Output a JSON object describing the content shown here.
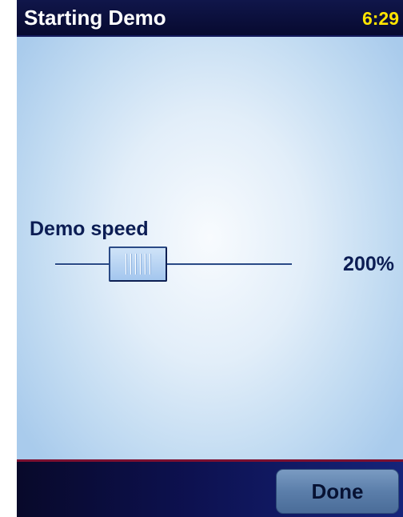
{
  "header": {
    "title": "Starting Demo",
    "clock": "6:29"
  },
  "setting": {
    "label": "Demo speed",
    "value_text": "200%",
    "slider_fraction": 0.3
  },
  "footer": {
    "done_label": "Done"
  },
  "colors": {
    "title_bar": "#070a30",
    "title_text": "#ffffff",
    "clock_text": "#ffe400",
    "label_text": "#0c1d54",
    "footer_divider": "#7c1030",
    "done_button": "#5b7eaa"
  }
}
